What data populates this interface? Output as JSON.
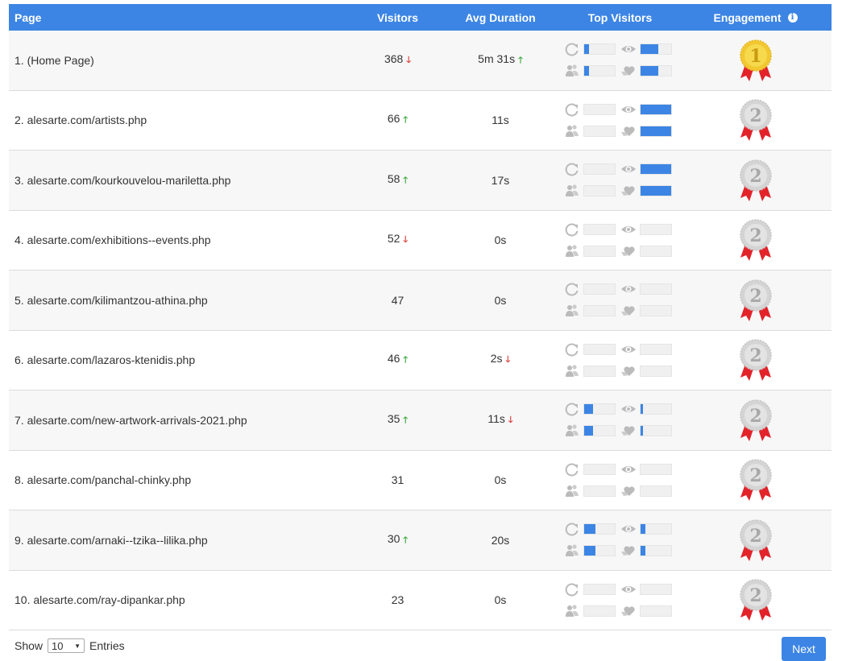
{
  "header": {
    "page": "Page",
    "visitors": "Visitors",
    "avg_duration": "Avg Duration",
    "top_visitors": "Top Visitors",
    "engagement": "Engagement"
  },
  "rows": [
    {
      "page": "1. (Home Page)",
      "visitors": "368",
      "vis_trend": "down",
      "duration": "5m 31s",
      "dur_trend": "up",
      "bars": [
        0.18,
        0.6,
        0.18,
        0.6
      ],
      "medal": "1"
    },
    {
      "page": "2. alesarte.com/artists.php",
      "visitors": "66",
      "vis_trend": "up",
      "duration": "11s",
      "dur_trend": "",
      "bars": [
        0,
        1,
        0,
        1
      ],
      "medal": "2"
    },
    {
      "page": "3. alesarte.com/kourkouvelou-mariletta.php",
      "visitors": "58",
      "vis_trend": "up",
      "duration": "17s",
      "dur_trend": "",
      "bars": [
        0,
        1,
        0,
        1
      ],
      "medal": "2"
    },
    {
      "page": "4. alesarte.com/exhibitions--events.php",
      "visitors": "52",
      "vis_trend": "down",
      "duration": "0s",
      "dur_trend": "",
      "bars": [
        0,
        0,
        0,
        0
      ],
      "medal": "2"
    },
    {
      "page": "5. alesarte.com/kilimantzou-athina.php",
      "visitors": "47",
      "vis_trend": "",
      "duration": "0s",
      "dur_trend": "",
      "bars": [
        0,
        0,
        0,
        0
      ],
      "medal": "2"
    },
    {
      "page": "6. alesarte.com/lazaros-ktenidis.php",
      "visitors": "46",
      "vis_trend": "up",
      "duration": "2s",
      "dur_trend": "down",
      "bars": [
        0,
        0,
        0,
        0
      ],
      "medal": "2"
    },
    {
      "page": "7. alesarte.com/new-artwork-arrivals-2021.php",
      "visitors": "35",
      "vis_trend": "up",
      "duration": "11s",
      "dur_trend": "down",
      "bars": [
        0.3,
        0.08,
        0.3,
        0.08
      ],
      "medal": "2"
    },
    {
      "page": "8. alesarte.com/panchal-chinky.php",
      "visitors": "31",
      "vis_trend": "",
      "duration": "0s",
      "dur_trend": "",
      "bars": [
        0,
        0,
        0,
        0
      ],
      "medal": "2"
    },
    {
      "page": "9. alesarte.com/arnaki--tzika--lilika.php",
      "visitors": "30",
      "vis_trend": "up",
      "duration": "20s",
      "dur_trend": "",
      "bars": [
        0.38,
        0.18,
        0.38,
        0.18
      ],
      "medal": "2"
    },
    {
      "page": "10. alesarte.com/ray-dipankar.php",
      "visitors": "23",
      "vis_trend": "",
      "duration": "0s",
      "dur_trend": "",
      "bars": [
        0,
        0,
        0,
        0
      ],
      "medal": "2"
    }
  ],
  "footer": {
    "show": "Show",
    "entries_value": "10",
    "entries": "Entries",
    "next": "Next"
  },
  "colors": {
    "accent": "#3c85e4",
    "up": "#3aa83a",
    "down": "#d9403a",
    "gold": "#f2c830",
    "silver": "#d4d4d4",
    "ribbon": "#e2232a"
  },
  "icons": [
    "refresh-icon",
    "eye-icon",
    "people-icon",
    "heart-hand-icon",
    "info-icon",
    "gold-medal-icon",
    "silver-medal-icon",
    "chevron-down-icon"
  ]
}
